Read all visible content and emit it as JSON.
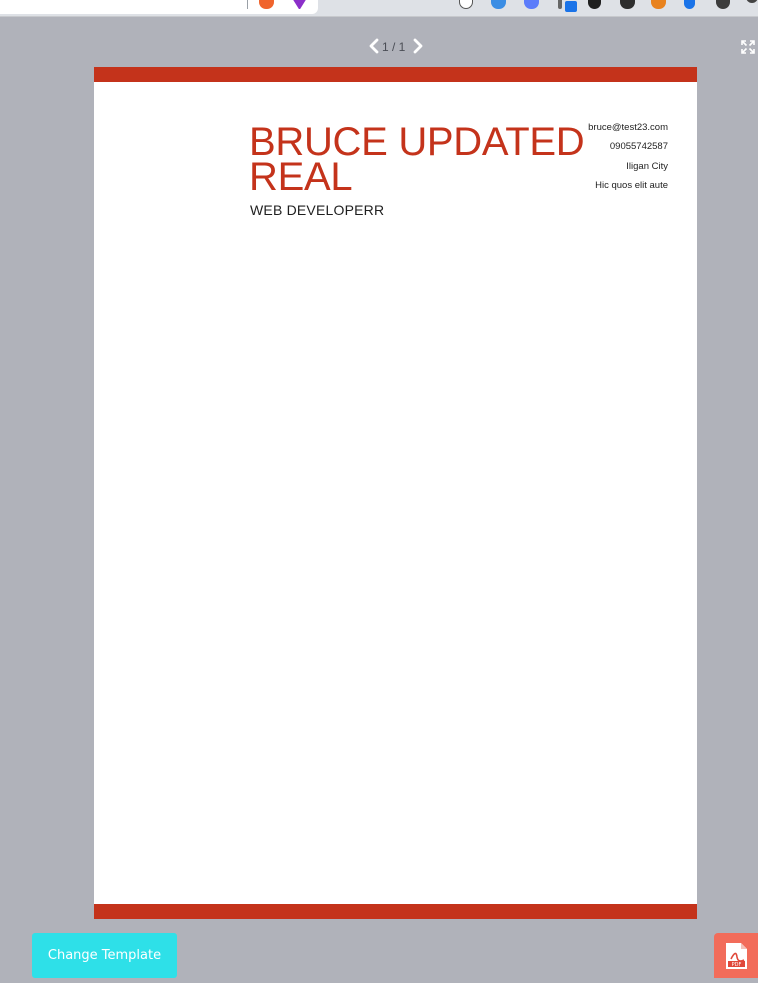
{
  "viewer": {
    "page_indicator": "1 / 1",
    "current_page": 1,
    "total_pages": 1
  },
  "resume": {
    "name": "BRUCE UPDATED REAL",
    "title": "WEB DEVELOPERR",
    "contact": {
      "email": "bruce@test23.com",
      "phone": "09055742587",
      "city": "Iligan City",
      "address": "Hic quos elit aute"
    }
  },
  "actions": {
    "change_template_label": "Change Template",
    "pdf_label": "PDF"
  },
  "colors": {
    "accent": "#c4331b",
    "background": "#b0b2ba",
    "button": "#2ee0e8",
    "pdf_button": "#f26c5a"
  },
  "icons": {
    "prev": "chevron-left-icon",
    "next": "chevron-right-icon",
    "fullscreen": "expand-icon",
    "pdf": "pdf-file-icon"
  }
}
